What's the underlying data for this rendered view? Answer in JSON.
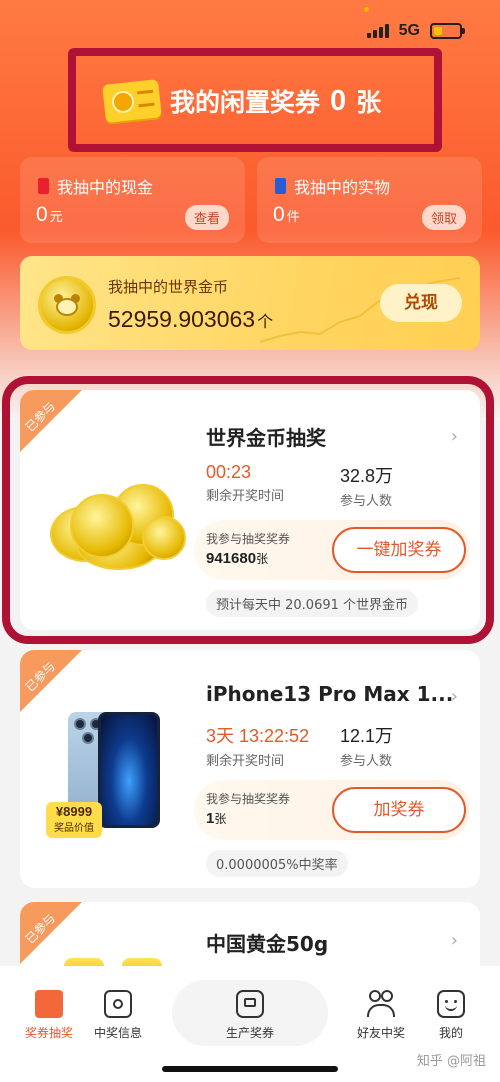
{
  "status": {
    "network": "5G"
  },
  "header": {
    "ticket_label": "我的闲置奖券",
    "ticket_count": "0",
    "ticket_unit": "张"
  },
  "cash_card": {
    "label": "我抽中的现金",
    "value": "0",
    "unit": "元",
    "button": "查看",
    "icon_color": "#e8212e"
  },
  "item_card": {
    "label": "我抽中的实物",
    "value": "0",
    "unit": "件",
    "button": "领取",
    "icon_color": "#2a5bd7"
  },
  "gold_card": {
    "label": "我抽中的世界金币",
    "value": "52959.903063",
    "unit": "个",
    "button": "兑现"
  },
  "lotteries": [
    {
      "badge": "已参与",
      "title": "世界金币抽奖",
      "time_value": "00:23",
      "time_label": "剩余开奖时间",
      "people_value": "32.8万",
      "people_label": "参与人数",
      "join_label": "我参与抽奖奖券",
      "join_value": "941680",
      "join_unit": "张",
      "button": "一键加奖券",
      "note": "预计每天中 20.0691 个世界金币"
    },
    {
      "badge": "已参与",
      "title": "iPhone13 Pro Max 1...",
      "time_value": "3天 13:22:52",
      "time_label": "剩余开奖时间",
      "people_value": "12.1万",
      "people_label": "参与人数",
      "join_label": "我参与抽奖奖券",
      "join_value": "1",
      "join_unit": "张",
      "button": "加奖券",
      "note": "0.0000005%中奖率",
      "price": "¥8999",
      "price_label": "奖品价值"
    },
    {
      "badge": "已参与",
      "title": "中国黄金50g"
    }
  ],
  "nav": [
    {
      "label": "奖券抽奖",
      "icon": "gift-icon",
      "active": true
    },
    {
      "label": "中奖信息",
      "icon": "camera-icon",
      "active": false
    },
    {
      "label": "生产奖券",
      "icon": "robot-icon",
      "active": false
    },
    {
      "label": "好友中奖",
      "icon": "friends-icon",
      "active": false
    },
    {
      "label": "我的",
      "icon": "face-icon",
      "active": false
    }
  ],
  "watermark": "知乎 @阿祖",
  "colors": {
    "accent": "#e4592b",
    "hero": "#fb5a2d",
    "gold": "#ffd561",
    "highlight_box": "#b01236"
  }
}
